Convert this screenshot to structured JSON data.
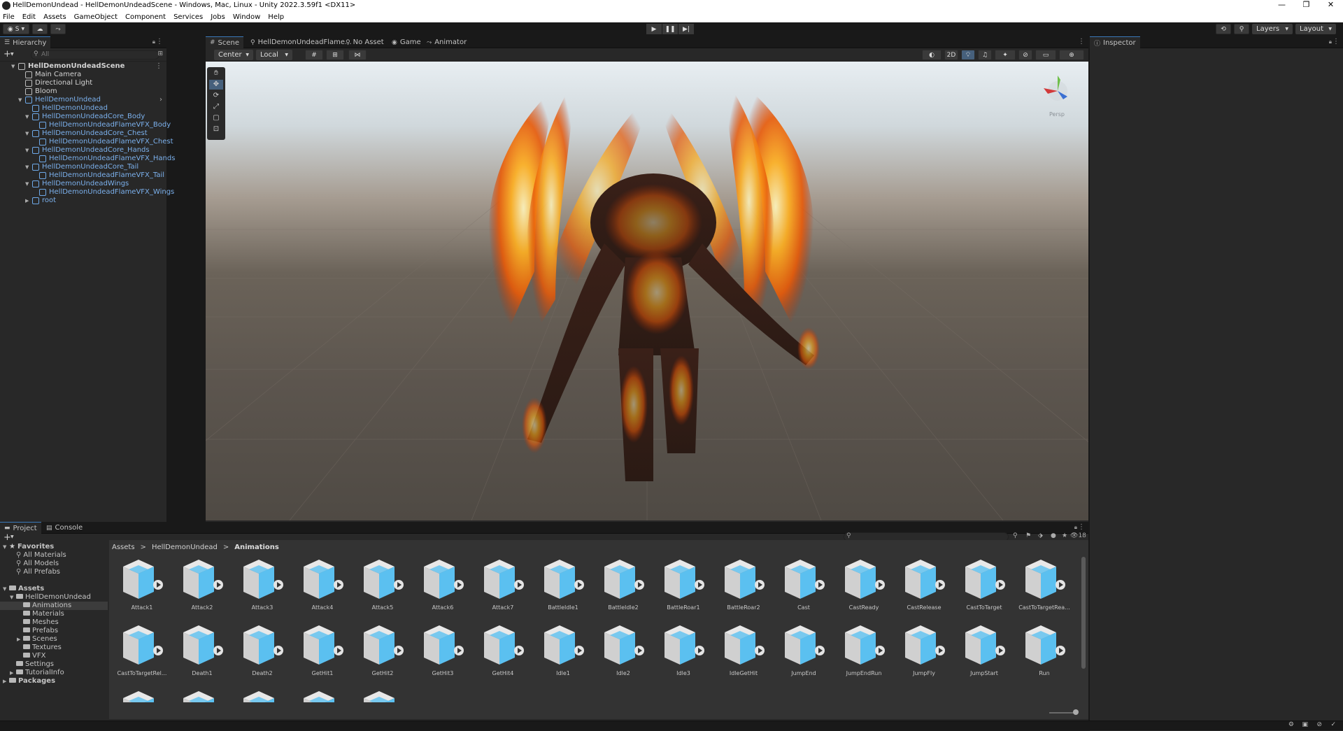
{
  "window": {
    "title": "HellDemonUndead - HellDemonUndeadScene - Windows, Mac, Linux - Unity 2022.3.59f1 <DX11>",
    "controls": [
      "—",
      "❐",
      "✕"
    ]
  },
  "menu": [
    "File",
    "Edit",
    "Assets",
    "GameObject",
    "Component",
    "Services",
    "Jobs",
    "Window",
    "Help"
  ],
  "toolbar": {
    "account_label": "S",
    "layers_label": "Layers",
    "layout_label": "Layout",
    "play": "▶",
    "pause": "❚❚",
    "step": "▶|"
  },
  "hierarchy": {
    "tab_label": "Hierarchy",
    "search_placeholder": "All",
    "items": [
      {
        "label": "HellDemonUndeadScene",
        "depth": 0
      },
      {
        "label": "Main Camera",
        "depth": 1
      },
      {
        "label": "Directional Light",
        "depth": 1
      },
      {
        "label": "Bloom",
        "depth": 1
      },
      {
        "label": "HellDemonUndead",
        "depth": 1
      },
      {
        "label": "HellDemonUndead",
        "depth": 2
      },
      {
        "label": "HellDemonUndeadCore_Body",
        "depth": 2
      },
      {
        "label": "HellDemonUndeadFlameVFX_Body",
        "depth": 3
      },
      {
        "label": "HellDemonUndeadCore_Chest",
        "depth": 2
      },
      {
        "label": "HellDemonUndeadFlameVFX_Chest",
        "depth": 3
      },
      {
        "label": "HellDemonUndeadCore_Hands",
        "depth": 2
      },
      {
        "label": "HellDemonUndeadFlameVFX_Hands",
        "depth": 3
      },
      {
        "label": "HellDemonUndeadCore_Tail",
        "depth": 2
      },
      {
        "label": "HellDemonUndeadFlameVFX_Tail",
        "depth": 3
      },
      {
        "label": "HellDemonUndeadWings",
        "depth": 2
      },
      {
        "label": "HellDemonUndeadFlameVFX_Wings",
        "depth": 3
      },
      {
        "label": "root",
        "depth": 2
      }
    ]
  },
  "scene_tabs": [
    {
      "label": "Scene",
      "icon": "#"
    },
    {
      "label": "HellDemonUndeadFlame...",
      "icon": "⚲"
    },
    {
      "label": "No Asset",
      "icon": "⚲"
    },
    {
      "label": "Game",
      "icon": "◉"
    },
    {
      "label": "Animator",
      "icon": "⤳"
    }
  ],
  "scene_toolbar": {
    "pivot_label": "Center",
    "space_label": "Local",
    "mode_2d": "2D",
    "gizmo_label": "Persp"
  },
  "inspector": {
    "tab_label": "Inspector"
  },
  "project": {
    "tabs": [
      "Project",
      "Console"
    ],
    "tree": [
      {
        "label": "Favorites",
        "depth": 0,
        "bold": true
      },
      {
        "label": "All Materials",
        "depth": 1
      },
      {
        "label": "All Models",
        "depth": 1
      },
      {
        "label": "All Prefabs",
        "depth": 1
      },
      {
        "label": "Assets",
        "depth": 0,
        "bold": true
      },
      {
        "label": "HellDemonUndead",
        "depth": 1
      },
      {
        "label": "Animations",
        "depth": 2,
        "selected": true
      },
      {
        "label": "Materials",
        "depth": 2
      },
      {
        "label": "Meshes",
        "depth": 2
      },
      {
        "label": "Prefabs",
        "depth": 2
      },
      {
        "label": "Scenes",
        "depth": 2
      },
      {
        "label": "Textures",
        "depth": 2
      },
      {
        "label": "VFX",
        "depth": 2
      },
      {
        "label": "Settings",
        "depth": 1
      },
      {
        "label": "TutorialInfo",
        "depth": 1
      },
      {
        "label": "Packages",
        "depth": 0,
        "bold": true
      }
    ],
    "breadcrumb": [
      "Assets",
      "HellDemonUndead",
      "Animations"
    ],
    "breadcrumb_sep": ">",
    "hidden_count": "18",
    "assets": [
      "Attack1",
      "Attack2",
      "Attack3",
      "Attack4",
      "Attack5",
      "Attack6",
      "Attack7",
      "BattleIdle1",
      "BattleIdle2",
      "BattleRoar1",
      "BattleRoar2",
      "Cast",
      "CastReady",
      "CastRelease",
      "CastToTarget",
      "CastToTargetRea...",
      "CastToTargetRel...",
      "Death1",
      "Death2",
      "GetHit1",
      "GetHit2",
      "GetHit3",
      "GetHit4",
      "Idle1",
      "Idle2",
      "Idle3",
      "IdleGetHit",
      "JumpEnd",
      "JumpEndRun",
      "JumpFly",
      "JumpStart",
      "Run"
    ],
    "partial_row_count": 5
  },
  "colors": {
    "accent": "#3a79bb",
    "asset_icon": "#5bc0f0",
    "prefab_text": "#7bb0ec"
  }
}
